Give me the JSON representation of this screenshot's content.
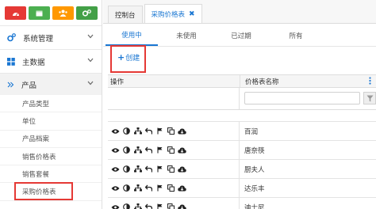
{
  "sidebar": {
    "shortcuts": [
      {
        "icon": "dashboard-icon",
        "color": "#e53935"
      },
      {
        "icon": "calendar-icon",
        "color": "#4caf50"
      },
      {
        "icon": "users-icon",
        "color": "#ff9800"
      },
      {
        "icon": "cogs-icon",
        "color": "#43a047"
      }
    ],
    "groups": [
      {
        "label": "系统管理",
        "icon": "gears-icon"
      },
      {
        "label": "主数据",
        "icon": "grid-icon"
      }
    ],
    "submenu": {
      "label": "产品",
      "icon": "double-chevron-icon"
    },
    "items": [
      "产品类型",
      "单位",
      "产品档案",
      "销售价格表",
      "销售套餐",
      "采购价格表"
    ]
  },
  "tabs": [
    {
      "label": "控制台",
      "active": false
    },
    {
      "label": "采购价格表",
      "active": true,
      "close": "✖"
    }
  ],
  "subtabs": [
    "使用中",
    "未使用",
    "已过期",
    "所有"
  ],
  "toolbar": {
    "create_label": "创建",
    "create_plus": "+"
  },
  "table": {
    "headers": {
      "ops": "操作",
      "name": "价格表名称"
    },
    "rows": [
      "百润",
      "唐奈筷",
      "厨夫人",
      "达乐丰",
      "迪士尼"
    ]
  },
  "colors": {
    "accent": "#1976d2",
    "highlight": "#e53935"
  }
}
